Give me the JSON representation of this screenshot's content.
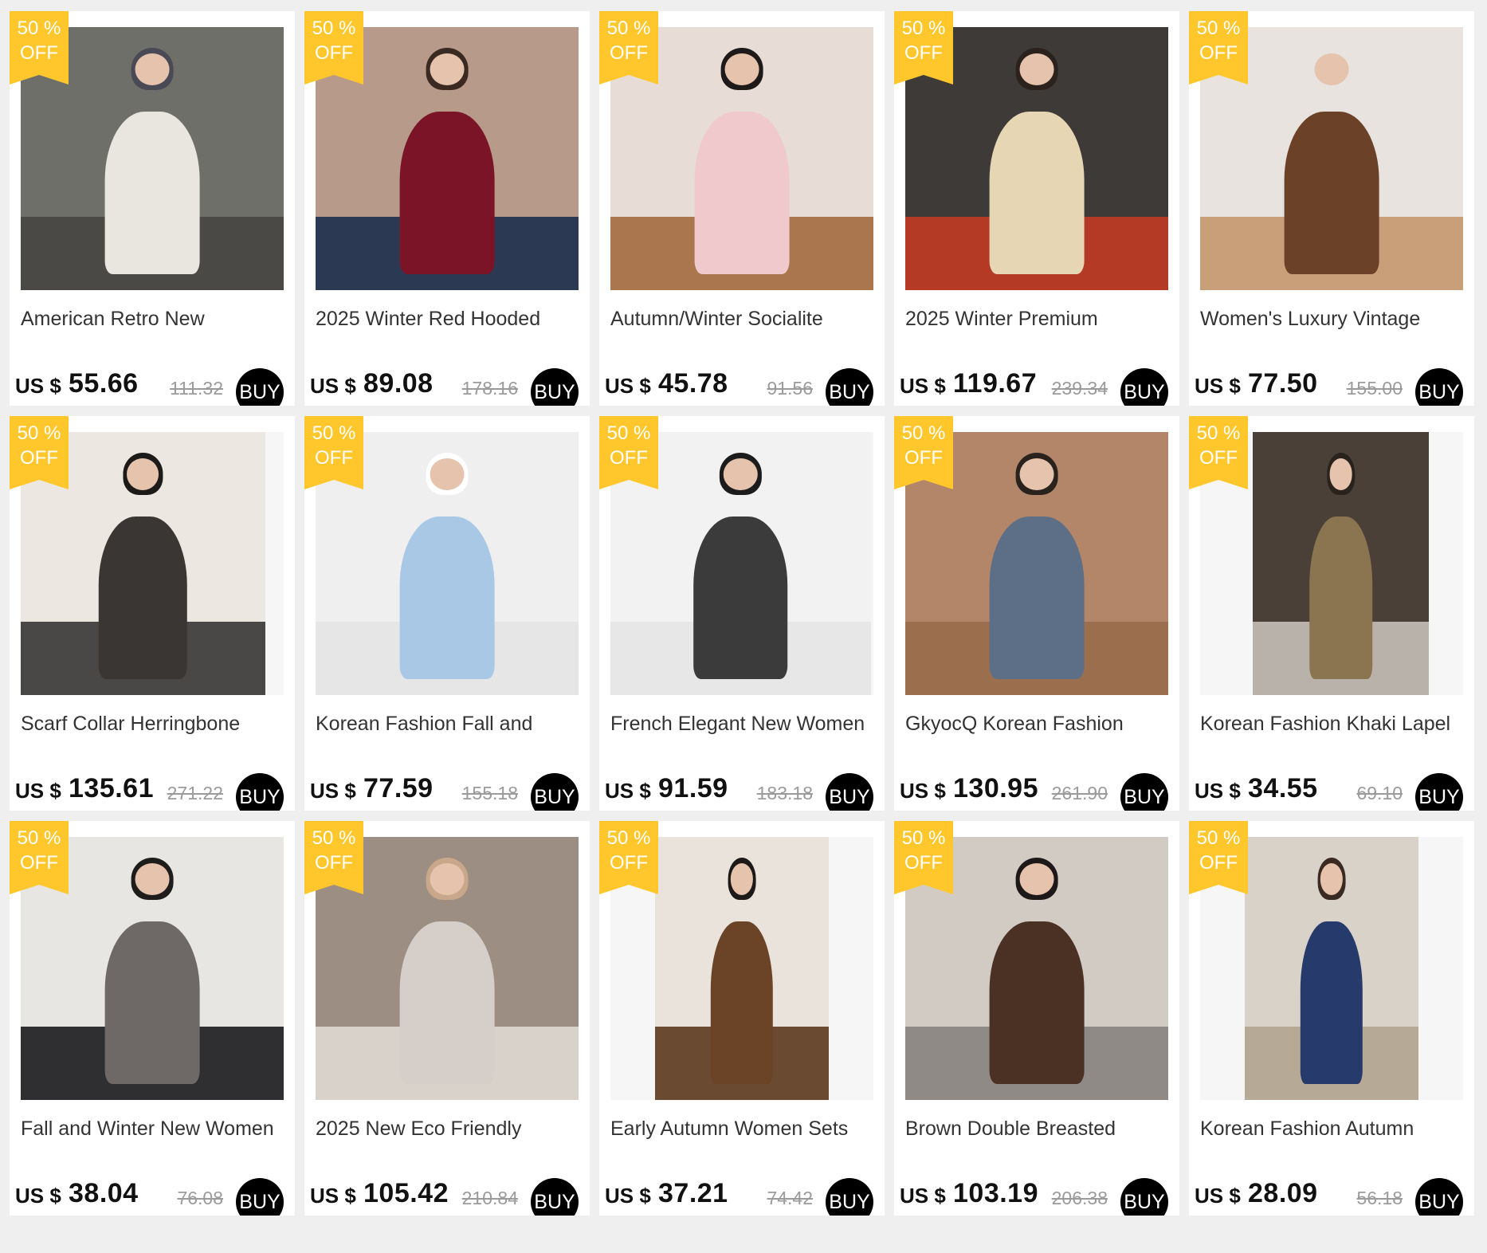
{
  "badge": {
    "line1": "50 %",
    "line2": "OFF"
  },
  "currency": "US $",
  "buy_label": "BUY",
  "products": [
    {
      "title": "American Retro New",
      "price": "55.66",
      "old_price": "111.32",
      "photo": {
        "bg": "#6f6f6a",
        "floor": "#4a4945",
        "garment": "#e9e6df",
        "hair": "#4a4a56",
        "inset": [
          0,
          0
        ]
      }
    },
    {
      "title": "2025 Winter Red Hooded",
      "price": "89.08",
      "old_price": "178.16",
      "photo": {
        "bg": "#b89a8a",
        "floor": "#2c3952",
        "garment": "#7a1426",
        "hair": "#3a2a22",
        "inset": [
          0,
          0
        ]
      }
    },
    {
      "title": "Autumn/Winter Socialite",
      "price": "45.78",
      "old_price": "91.56",
      "photo": {
        "bg": "#e7ddd6",
        "floor": "#a9764d",
        "garment": "#efc9cc",
        "hair": "#1e1a1a",
        "inset": [
          0,
          0
        ]
      }
    },
    {
      "title": "2025 Winter Premium",
      "price": "119.67",
      "old_price": "239.34",
      "photo": {
        "bg": "#3d3a38",
        "floor": "#b43a25",
        "garment": "#e6d6b4",
        "hair": "#2b221d",
        "inset": [
          0,
          0
        ]
      }
    },
    {
      "title": "Women's Luxury Vintage",
      "price": "77.50",
      "old_price": "155.00",
      "photo": {
        "bg": "#e8e3df",
        "floor": "#c99f7a",
        "garment": "#6b4127",
        "hair": "#e8e3df",
        "inset": [
          0,
          0
        ]
      }
    },
    {
      "title": "Scarf Collar Herringbone",
      "price": "135.61",
      "old_price": "271.22",
      "photo": {
        "bg": "#ece7e1",
        "floor": "#4a4847",
        "garment": "#3a3634",
        "hair": "#1d1a1a",
        "inset": [
          0,
          0.07
        ]
      }
    },
    {
      "title": "Korean Fashion Fall and",
      "price": "77.59",
      "old_price": "155.18",
      "photo": {
        "bg": "#efefef",
        "floor": "#e6e6e6",
        "garment": "#a9c8e6",
        "hair": "#ffffff",
        "inset": [
          0,
          0
        ]
      }
    },
    {
      "title": "French Elegant New Women",
      "price": "91.59",
      "old_price": "183.18",
      "photo": {
        "bg": "#f2f2f2",
        "floor": "#e7e7e7",
        "garment": "#3b3b3b",
        "hair": "#1c1c1c",
        "inset": [
          0,
          0.01
        ]
      }
    },
    {
      "title": "GkyocQ Korean Fashion",
      "price": "130.95",
      "old_price": "261.90",
      "photo": {
        "bg": "#b3866a",
        "floor": "#9b6f4e",
        "garment": "#5d6f87",
        "hair": "#2a221d",
        "inset": [
          0,
          0
        ]
      }
    },
    {
      "title": "Korean Fashion Khaki Lapel",
      "price": "34.55",
      "old_price": "69.10",
      "photo": {
        "bg": "#4a4037",
        "floor": "#b8b2ab",
        "garment": "#8b7550",
        "hair": "#2a221d",
        "inset": [
          0.2,
          0.13
        ]
      }
    },
    {
      "title": "Fall and Winter New Women",
      "price": "38.04",
      "old_price": "76.08",
      "photo": {
        "bg": "#e7e6e2",
        "floor": "#2f2f31",
        "garment": "#6e6966",
        "hair": "#1f1c1c",
        "inset": [
          0,
          0
        ]
      }
    },
    {
      "title": "2025 New Eco Friendly",
      "price": "105.42",
      "old_price": "210.84",
      "photo": {
        "bg": "#9c8e82",
        "floor": "#d8d2cb",
        "garment": "#d6cfc9",
        "hair": "#c9a78a",
        "inset": [
          0,
          0
        ]
      }
    },
    {
      "title": "Early Autumn Women Sets",
      "price": "37.21",
      "old_price": "74.42",
      "photo": {
        "bg": "#e9e3dc",
        "floor": "#6a4b32",
        "garment": "#6b4327",
        "hair": "#1d1918",
        "inset": [
          0.17,
          0.17
        ]
      }
    },
    {
      "title": "Brown Double Breasted",
      "price": "103.19",
      "old_price": "206.38",
      "photo": {
        "bg": "#d2cbc4",
        "floor": "#8f8a85",
        "garment": "#4a3124",
        "hair": "#1d1918",
        "inset": [
          0,
          0
        ]
      }
    },
    {
      "title": "Korean Fashion Autumn",
      "price": "28.09",
      "old_price": "56.18",
      "photo": {
        "bg": "#d8d2c9",
        "floor": "#b6a996",
        "garment": "#263a6b",
        "hair": "#3a2a22",
        "inset": [
          0.17,
          0.17
        ]
      }
    }
  ]
}
